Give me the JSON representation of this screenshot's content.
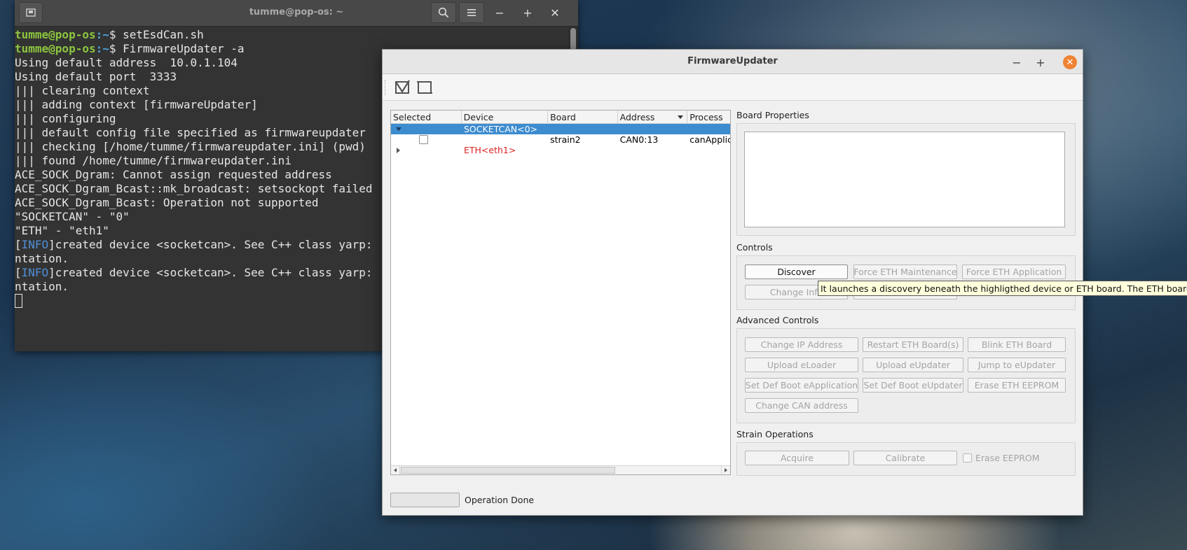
{
  "terminal": {
    "title": "tumme@pop-os: ~",
    "lines": [
      {
        "user": "tumme@pop-os",
        "path": ":~",
        "cmd": "$ setEsdCan.sh"
      },
      {
        "user": "tumme@pop-os",
        "path": ":~",
        "cmd": "$ FirmwareUpdater -a"
      }
    ],
    "output": [
      "Using default address  10.0.1.104",
      "Using default port  3333",
      "||| clearing context",
      "||| adding context [firmwareUpdater]",
      "||| configuring",
      "||| default config file specified as firmwareupdater",
      "||| checking [/home/tumme/firmwareupdater.ini] (pwd)",
      "||| found /home/tumme/firmwareupdater.ini",
      "ACE_SOCK_Dgram: Cannot assign requested address",
      "ACE_SOCK_Dgram_Bcast::mk_broadcast: setsockopt failed",
      "ACE_SOCK_Dgram_Bcast: Operation not supported",
      "\"SOCKETCAN\" - \"0\"",
      "\"ETH\" - \"eth1\""
    ],
    "info_lines": [
      {
        "prefix": "[",
        "tag": "INFO",
        "rest": "]created device <socketcan>. See C++ class yarp:",
        "cont": "ntation."
      },
      {
        "prefix": "[",
        "tag": "INFO",
        "rest": "]created device <socketcan>. See C++ class yarp:",
        "cont": "ntation."
      }
    ]
  },
  "app": {
    "title": "FirmwareUpdater",
    "tree": {
      "columns": [
        "Selected",
        "Device",
        "Board",
        "Address",
        "Process"
      ],
      "rows": [
        {
          "device": "SOCKETCAN<0>",
          "selected": true
        },
        {
          "board": "strain2",
          "address": "CAN0:13",
          "process": "canApplic"
        },
        {
          "device": "ETH<eth1>"
        }
      ]
    },
    "board_properties_label": "Board Properties",
    "controls": {
      "label": "Controls",
      "discover": "Discover",
      "force_eth_maintenance": "Force ETH Maintenance",
      "force_eth_application": "Force ETH Application",
      "change_info": "Change Info"
    },
    "tooltip": "It launches a discovery beneath the highligthed device or ETH board. The ETH boards a",
    "advanced": {
      "label": "Advanced Controls",
      "change_ip": "Change IP Address",
      "restart_eth": "Restart ETH Board(s)",
      "blink_eth": "Blink ETH Board",
      "upload_eloader": "Upload eLoader",
      "upload_eupdater": "Upload eUpdater",
      "jump_eupdater": "Jump to eUpdater",
      "def_boot_eapp": "Set Def Boot eApplication",
      "def_boot_eupd": "Set Def Boot eUpdater",
      "erase_eth_eeprom": "Erase ETH EEPROM",
      "change_can": "Change CAN address"
    },
    "strain": {
      "label": "Strain Operations",
      "acquire": "Acquire",
      "calibrate": "Calibrate",
      "erase_eeprom": "Erase EEPROM"
    },
    "status": "Operation Done"
  }
}
